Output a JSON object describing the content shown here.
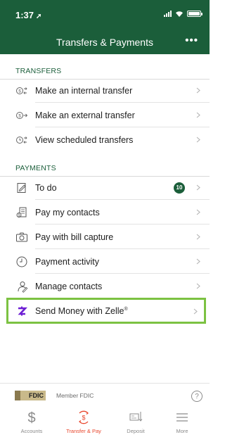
{
  "status_bar": {
    "time": "1:37"
  },
  "header": {
    "title": "Transfers & Payments",
    "more_label": "•••"
  },
  "transfers": {
    "heading": "TRANSFERS",
    "items": [
      {
        "label": "Make an internal transfer",
        "icon": "internal-transfer-icon"
      },
      {
        "label": "Make an external transfer",
        "icon": "external-transfer-icon"
      },
      {
        "label": "View scheduled transfers",
        "icon": "scheduled-transfers-icon"
      }
    ]
  },
  "payments": {
    "heading": "PAYMENTS",
    "items": [
      {
        "label": "To do",
        "icon": "todo-icon",
        "badge": "10"
      },
      {
        "label": "Pay my contacts",
        "icon": "pay-contacts-icon"
      },
      {
        "label": "Pay with bill capture",
        "icon": "camera-icon"
      },
      {
        "label": "Payment activity",
        "icon": "clock-icon"
      },
      {
        "label": "Manage contacts",
        "icon": "contacts-icon"
      }
    ]
  },
  "zelle": {
    "label": "Send Money with Zelle",
    "mark": "®",
    "icon": "zelle-icon"
  },
  "footer": {
    "fdic_logo": "FDIC",
    "fdic_text": "Member FDIC",
    "help": "?"
  },
  "tabs": [
    {
      "label": "Accounts",
      "icon": "dollar-icon",
      "active": false
    },
    {
      "label": "Transfer & Pay",
      "icon": "transfer-pay-icon",
      "active": true
    },
    {
      "label": "Deposit",
      "icon": "deposit-check-icon",
      "active": false
    },
    {
      "label": "More",
      "icon": "menu-icon",
      "active": false
    }
  ],
  "colors": {
    "brand_green": "#1b5e3a",
    "zelle_highlight": "#7cc242",
    "active_tab": "#e8472d",
    "zelle_purple": "#6d1ed4"
  }
}
